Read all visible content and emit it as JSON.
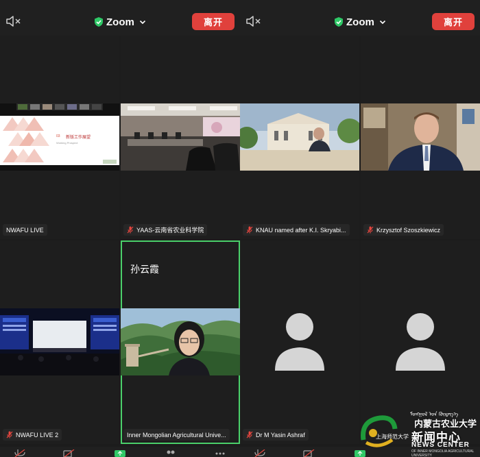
{
  "windows": [
    {
      "title": "Zoom",
      "leave_label": "离开",
      "tiles": [
        {
          "name": "NWAFU LIVE",
          "mic_muted": false
        },
        {
          "name": "YAAS-云南省农业科学院",
          "mic_muted": true
        },
        {
          "name": "NWAFU LIVE 2",
          "mic_muted": true
        },
        {
          "name": "Inner Mongolian Agricultural Unive...",
          "mic_muted": false,
          "display_name": "孙云霞",
          "active": true
        }
      ]
    },
    {
      "title": "Zoom",
      "leave_label": "离开",
      "tiles": [
        {
          "name": "KNAU named after K.I. Skryabi...",
          "mic_muted": true
        },
        {
          "name": "Krzysztof Szoszkiewicz",
          "mic_muted": true
        },
        {
          "name": "Dr M Yasin Ashraf",
          "mic_muted": true,
          "video_off": true
        },
        {
          "name": "",
          "video_off": true
        }
      ]
    }
  ],
  "slide": {
    "number": "03",
    "title": "新版工作展望",
    "subtitle": "Working Prospect"
  },
  "watermark": {
    "mongolian": "ᠮᠣᠩᠭᠣᠯ ᠤᠨ ᠬᠥᠳᠡᠭ᠎ᠡ",
    "university": "内蒙古农业大学",
    "news_cn": "新闻中心",
    "news_en": "NEWS CENTER",
    "sub_en": "OF INNER MONGOLIA AGRICULTURAL UNIVERSITY",
    "shnu": "上海师范大学"
  },
  "colors": {
    "leave_button": "#e0413c",
    "active_border": "#4ad06a",
    "shield": "#2ec866",
    "muted_mic": "#e8463f"
  }
}
